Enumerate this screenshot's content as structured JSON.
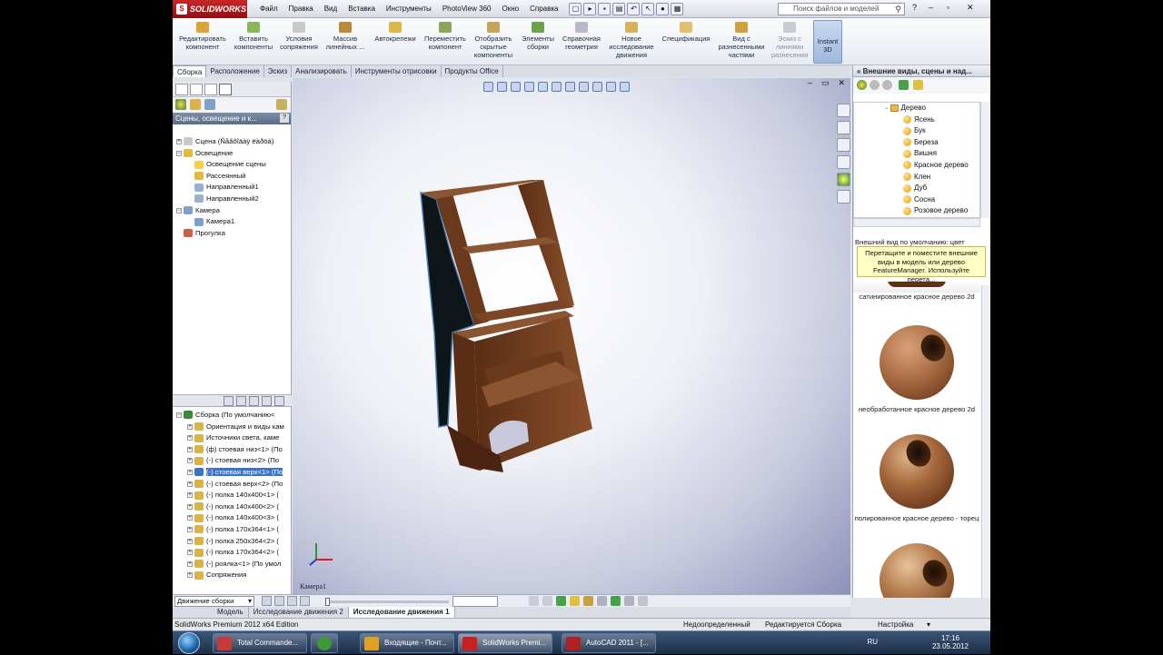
{
  "app": {
    "brand": "SOLIDWORKS",
    "menu": [
      "Файл",
      "Правка",
      "Вид",
      "Вставка",
      "Инструменты",
      "PhotoView 360",
      "Окно",
      "Справка"
    ],
    "search_placeholder": "Поиск файлов и моделей"
  },
  "ribbon": {
    "buttons": [
      "Редактировать компонент",
      "Вставить компоненты",
      "Условия сопряжения",
      "Массив линейных ...",
      "Автокрепежи",
      "Переместить компонент",
      "Отобразить скрытые компоненты",
      "Элементы сборки",
      "Справочная геометрия",
      "Новое исследование движения",
      "Спецификация",
      "Вид с разнесенными частями",
      "Эскиз с линиями разнесения"
    ],
    "instant3d": "Instant 3D"
  },
  "command_tabs": [
    "Сборка",
    "Расположение",
    "Эскиз",
    "Анализировать",
    "Инструменты отрисовки",
    "Продукты Office"
  ],
  "left_panel": {
    "header": "Сцены, освещение и к...",
    "help": "?",
    "scene_tree": [
      {
        "label": "Сцена (Ñåãôîäàÿ ëàðöà)",
        "level": 0,
        "expander": "+"
      },
      {
        "label": "Освещение",
        "level": 0,
        "expander": "−"
      },
      {
        "label": "Освещение сцены",
        "level": 1,
        "expander": ""
      },
      {
        "label": "Рассеянный",
        "level": 1,
        "expander": ""
      },
      {
        "label": "Направленный1",
        "level": 1,
        "expander": ""
      },
      {
        "label": "Направленный2",
        "level": 1,
        "expander": ""
      },
      {
        "label": "Камера",
        "level": 0,
        "expander": "−"
      },
      {
        "label": "Камера1",
        "level": 1,
        "expander": ""
      },
      {
        "label": "Прогулка",
        "level": 0,
        "expander": ""
      }
    ],
    "feature_tree": [
      {
        "label": "Сборка  (По умолчанию<",
        "level": 0,
        "selected": false
      },
      {
        "label": "Ориентация и виды кам",
        "level": 1,
        "selected": false
      },
      {
        "label": "Источники света, каме",
        "level": 1,
        "selected": false
      },
      {
        "label": "(ф) стоевая низ<1> (По",
        "level": 1,
        "selected": false
      },
      {
        "label": "(-) стоевая низ<2> (По",
        "level": 1,
        "selected": false
      },
      {
        "label": "(-) стоевая верх<1> (По",
        "level": 1,
        "selected": true
      },
      {
        "label": "(-) стоевая верх<2> (По",
        "level": 1,
        "selected": false
      },
      {
        "label": "(-) полка 140x400<1> (",
        "level": 1,
        "selected": false
      },
      {
        "label": "(-) полка 140x400<2> (",
        "level": 1,
        "selected": false
      },
      {
        "label": "(-) полка 140x400<3> (",
        "level": 1,
        "selected": false
      },
      {
        "label": "(-) полка 170x364<1> (",
        "level": 1,
        "selected": false
      },
      {
        "label": "(-) полка 250x364<2> (",
        "level": 1,
        "selected": false
      },
      {
        "label": "(-) полка 170x364<2> (",
        "level": 1,
        "selected": false
      },
      {
        "label": "(-) роялка<1> (По умол",
        "level": 1,
        "selected": false
      },
      {
        "label": "Сопряжения",
        "level": 1,
        "selected": false
      }
    ]
  },
  "viewport": {
    "camera_label": "Камера1"
  },
  "right_panel": {
    "title": "« Внешние виды, сцены и над...",
    "tree_parent": "Дерево",
    "tree_items": [
      "Ясень",
      "Бук",
      "Береза",
      "Вишня",
      "Красное дерево",
      "Клен",
      "Дуб",
      "Сосна",
      "Розовое дерево"
    ],
    "default_appearance": "Внешний вид по умолчанию: цвет",
    "tip": "Перетащите и поместите внешние виды в модель или дерево FeatureManager. Используйте перета...",
    "thumbnails": [
      {
        "caption": "сатинированное красное дерево 2d"
      },
      {
        "caption": "необработанное красное дерево 2d"
      },
      {
        "caption": "полированное красное дерево - торец"
      },
      {
        "caption": ""
      }
    ]
  },
  "motion": {
    "study_select": "Движение сборки",
    "tabs": [
      "Модель",
      "Исследование движения 2",
      "Исследование движения 1"
    ],
    "active_tab": 2
  },
  "status": {
    "edition": "SolidWorks Premium 2012 x64 Edition",
    "state": "Недоопределенный",
    "editing": "Редактируется Сборка",
    "settings": "Настройка"
  },
  "taskbar": {
    "buttons": [
      {
        "label": "Total Commande...",
        "icon": "pe-icon",
        "color": "#c83a3a"
      },
      {
        "label": "",
        "icon": "chrome-icon",
        "color": "#3a9a3a"
      },
      {
        "label": "Входящие - Почт...",
        "icon": "outlook-icon",
        "color": "#e0a020"
      },
      {
        "label": "SolidWorks Premi...",
        "icon": "solidworks-icon",
        "color": "#c82020"
      },
      {
        "label": "AutoCAD 2011 - [...",
        "icon": "autocad-icon",
        "color": "#b02020"
      }
    ],
    "lang": "RU",
    "time": "17:16",
    "date": "23.05.2012"
  }
}
